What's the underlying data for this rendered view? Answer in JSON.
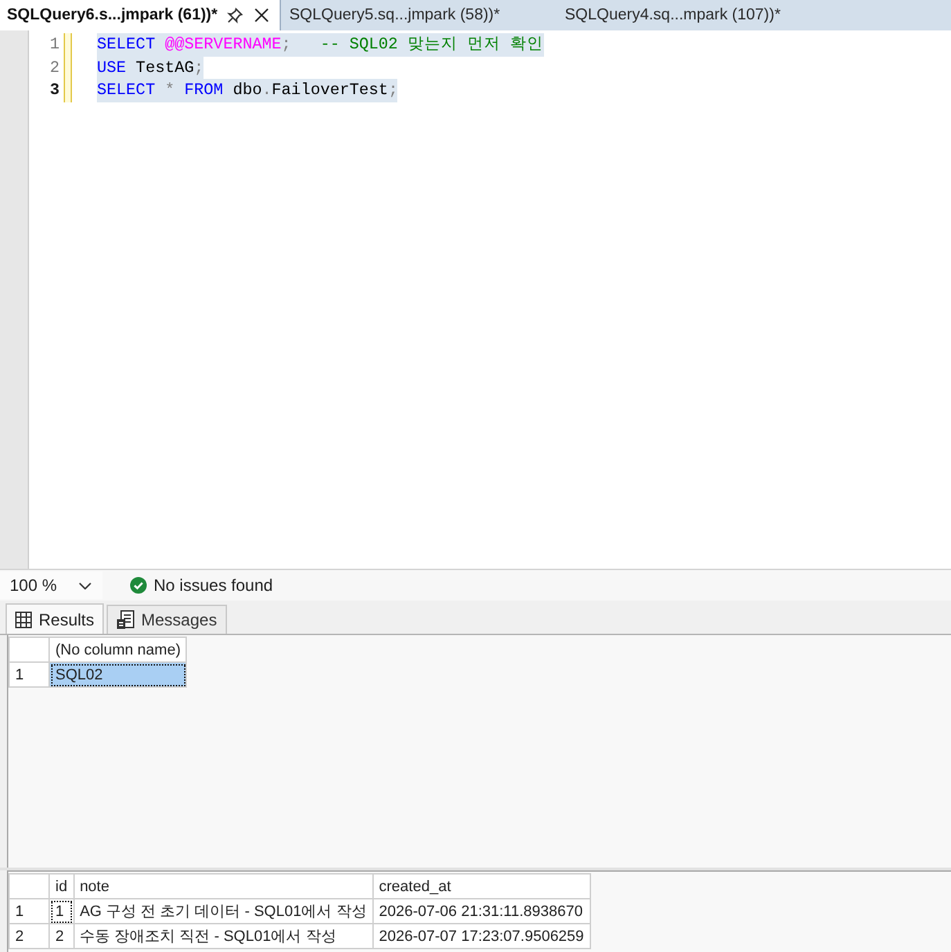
{
  "tabs": [
    {
      "label": "SQLQuery6.s...jmpark (61))*",
      "selected": true
    },
    {
      "label": "SQLQuery5.sq...jmpark (58))*",
      "selected": false
    },
    {
      "label": "SQLQuery4.sq...mpark (107))*",
      "selected": false
    }
  ],
  "editor": {
    "lines": [
      {
        "number": "1",
        "current": false,
        "changed": true,
        "selected": true,
        "tokens": [
          {
            "kind": "keyword",
            "text": "SELECT"
          },
          {
            "kind": "variable",
            "text": " @@SERVERNAME"
          },
          {
            "kind": "operator",
            "text": ";"
          },
          {
            "kind": "comment",
            "text": "   -- SQL02 맞는지 먼저 확인"
          }
        ]
      },
      {
        "number": "2",
        "current": false,
        "changed": true,
        "selected": true,
        "tokens": [
          {
            "kind": "keyword",
            "text": "USE"
          },
          {
            "kind": "identifier",
            "text": " TestAG"
          },
          {
            "kind": "operator",
            "text": ";"
          }
        ]
      },
      {
        "number": "3",
        "current": true,
        "changed": true,
        "selected": true,
        "tokens": [
          {
            "kind": "keyword",
            "text": "SELECT"
          },
          {
            "kind": "operator",
            "text": " *"
          },
          {
            "kind": "keyword",
            "text": " FROM"
          },
          {
            "kind": "identifier",
            "text": " dbo"
          },
          {
            "kind": "operator",
            "text": "."
          },
          {
            "kind": "identifier",
            "text": "FailoverTest"
          },
          {
            "kind": "operator",
            "text": ";"
          }
        ]
      }
    ]
  },
  "status_bar": {
    "zoom": "100 %",
    "issues": "No issues found"
  },
  "results_tabs": [
    {
      "label": "Results",
      "selected": true
    },
    {
      "label": "Messages",
      "selected": false
    }
  ],
  "result_grids": [
    {
      "columns": [
        "(No column name)"
      ],
      "rows": [
        {
          "number": "1",
          "cells": [
            {
              "text": "SQL02",
              "selected": true,
              "focused": true
            }
          ]
        }
      ]
    },
    {
      "columns": [
        "id",
        "note",
        "created_at"
      ],
      "rows": [
        {
          "number": "1",
          "cells": [
            {
              "text": "1",
              "selected": false,
              "focused": true
            },
            {
              "text": "AG 구성 전 초기 데이터 - SQL01에서 작성",
              "selected": false,
              "focused": false
            },
            {
              "text": "2026-07-06 21:31:11.8938670",
              "selected": false,
              "focused": false
            }
          ]
        },
        {
          "number": "2",
          "cells": [
            {
              "text": "2",
              "selected": false,
              "focused": false
            },
            {
              "text": "수동 장애조치 직전 - SQL01에서 작성",
              "selected": false,
              "focused": false
            },
            {
              "text": "2026-07-07 17:23:07.9506259",
              "selected": false,
              "focused": false
            }
          ]
        }
      ]
    }
  ]
}
